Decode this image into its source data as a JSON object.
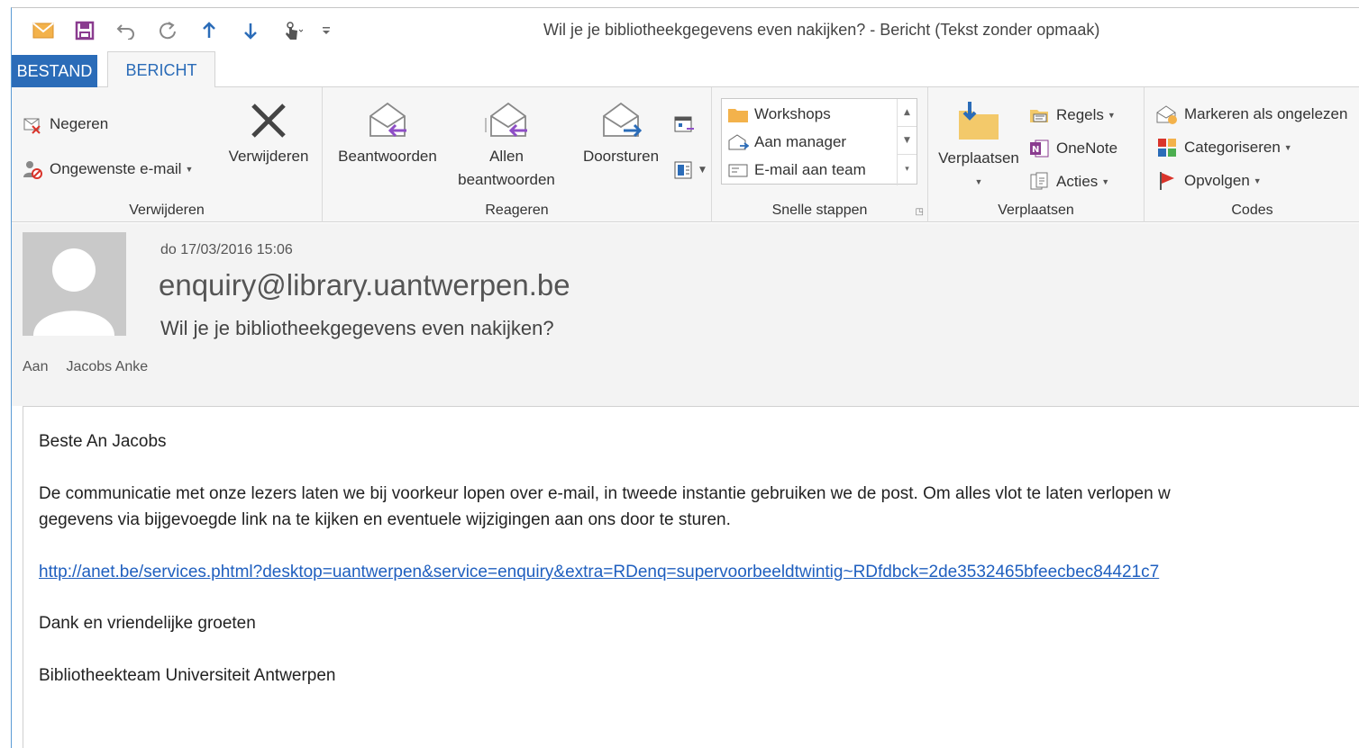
{
  "window": {
    "title": "Wil je je bibliotheekgegevens even nakijken? - Bericht (Tekst zonder opmaak)"
  },
  "qat": {
    "icons": [
      "mail-icon",
      "save-icon",
      "undo-icon",
      "redo-icon",
      "up-arrow-icon",
      "down-arrow-icon",
      "touch-mode-icon",
      "customize-icon"
    ]
  },
  "tabs": {
    "file": "BESTAND",
    "message": "BERICHT"
  },
  "ribbon": {
    "delete_group": {
      "label": "Verwijderen",
      "ignore": "Negeren",
      "junk": "Ongewenste e-mail",
      "delete": "Verwijderen"
    },
    "reply_group": {
      "label": "Reageren",
      "reply": "Beantwoorden",
      "reply_all_line1": "Allen",
      "reply_all_line2": "beantwoorden",
      "forward": "Doorsturen"
    },
    "quick_steps": {
      "label": "Snelle stappen",
      "items": [
        "Workshops",
        "Aan manager",
        "E-mail aan team"
      ]
    },
    "move_group": {
      "label": "Verplaatsen",
      "move": "Verplaatsen",
      "rules": "Regels",
      "onenote": "OneNote",
      "actions": "Acties"
    },
    "tags_group": {
      "label": "Codes",
      "mark_unread": "Markeren als ongelezen",
      "categorize": "Categoriseren",
      "follow_up": "Opvolgen"
    }
  },
  "message": {
    "date": "do 17/03/2016 15:06",
    "from": "enquiry@library.uantwerpen.be",
    "subject": "Wil je je bibliotheekgegevens even nakijken?",
    "to_label": "Aan",
    "to_value": "Jacobs Anke"
  },
  "body": {
    "greeting": "Beste An Jacobs",
    "line1": "De communicatie met onze lezers laten we bij voorkeur lopen over e-mail, in tweede instantie gebruiken we de post. Om alles vlot te laten verlopen w",
    "line2": "gegevens via bijgevoegde link na te kijken en eventuele wijzigingen aan ons door te sturen.",
    "link": "http://anet.be/services.phtml?desktop=uantwerpen&service=enquiry&extra=RDenq=supervoorbeeldtwintig~RDfdbck=2de3532465bfeecbec84421c7",
    "closing": "Dank en vriendelijke groeten",
    "signature": "Bibliotheekteam Universiteit Antwerpen"
  },
  "colors": {
    "accent": "#2b6cb8",
    "link": "#1f5fbf",
    "envelope": "#f0a93b",
    "reply_arrow": "#8e4ec6",
    "forward_arrow": "#2b6cb8",
    "flag": "#d9342b"
  }
}
